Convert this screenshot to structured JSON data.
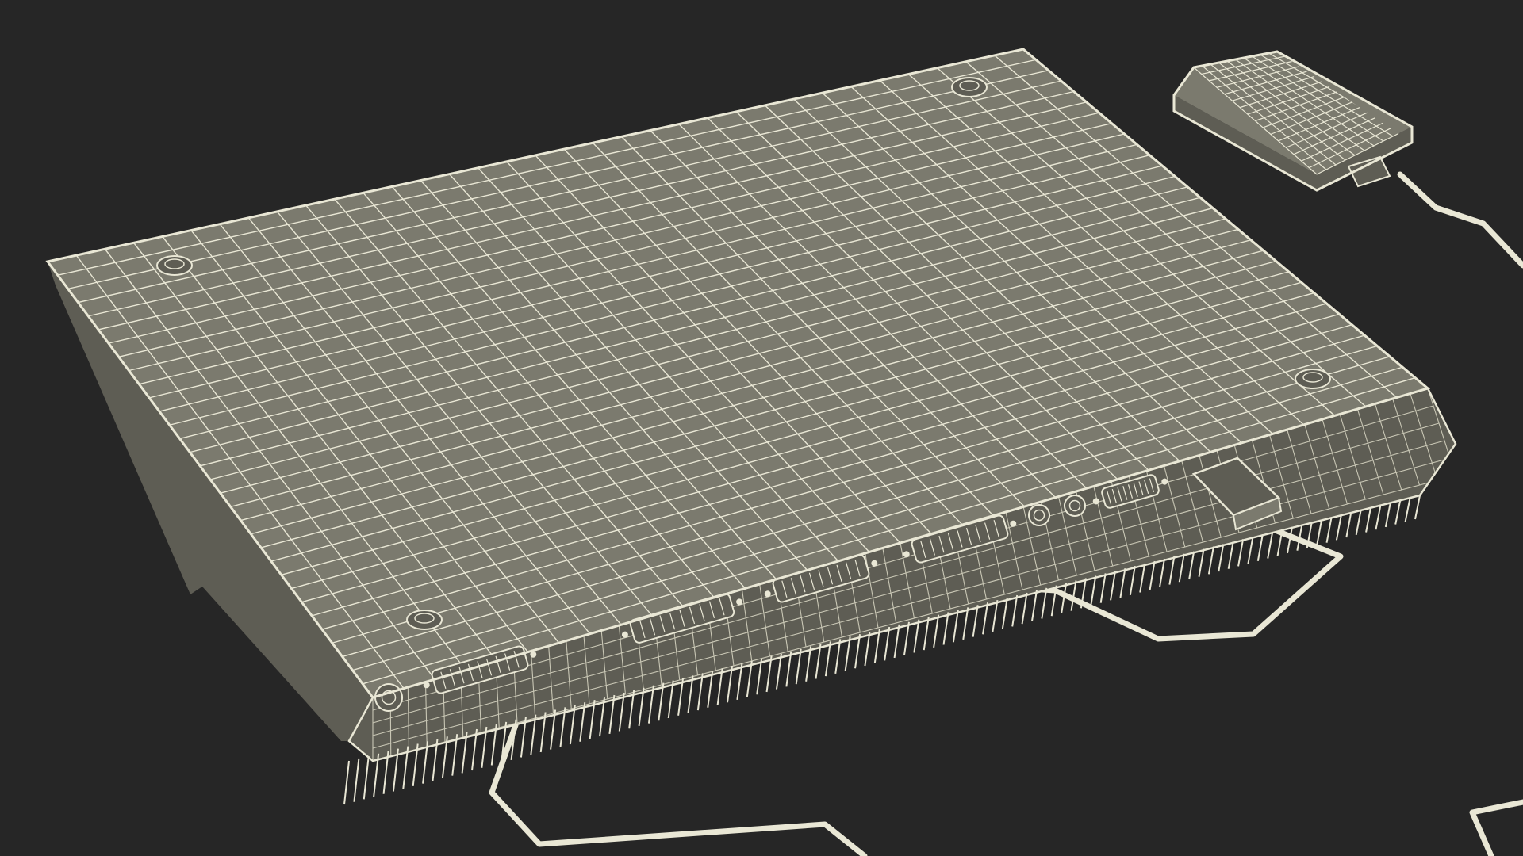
{
  "scene": {
    "subject": "laptop-bottom-wireframe-render",
    "colors": {
      "background": "#262626",
      "surface": "#7b7a6e",
      "surface_dark": "#5e5d54",
      "wire": "#e9e7d5",
      "wire_dim": "#c9c7b5"
    }
  }
}
